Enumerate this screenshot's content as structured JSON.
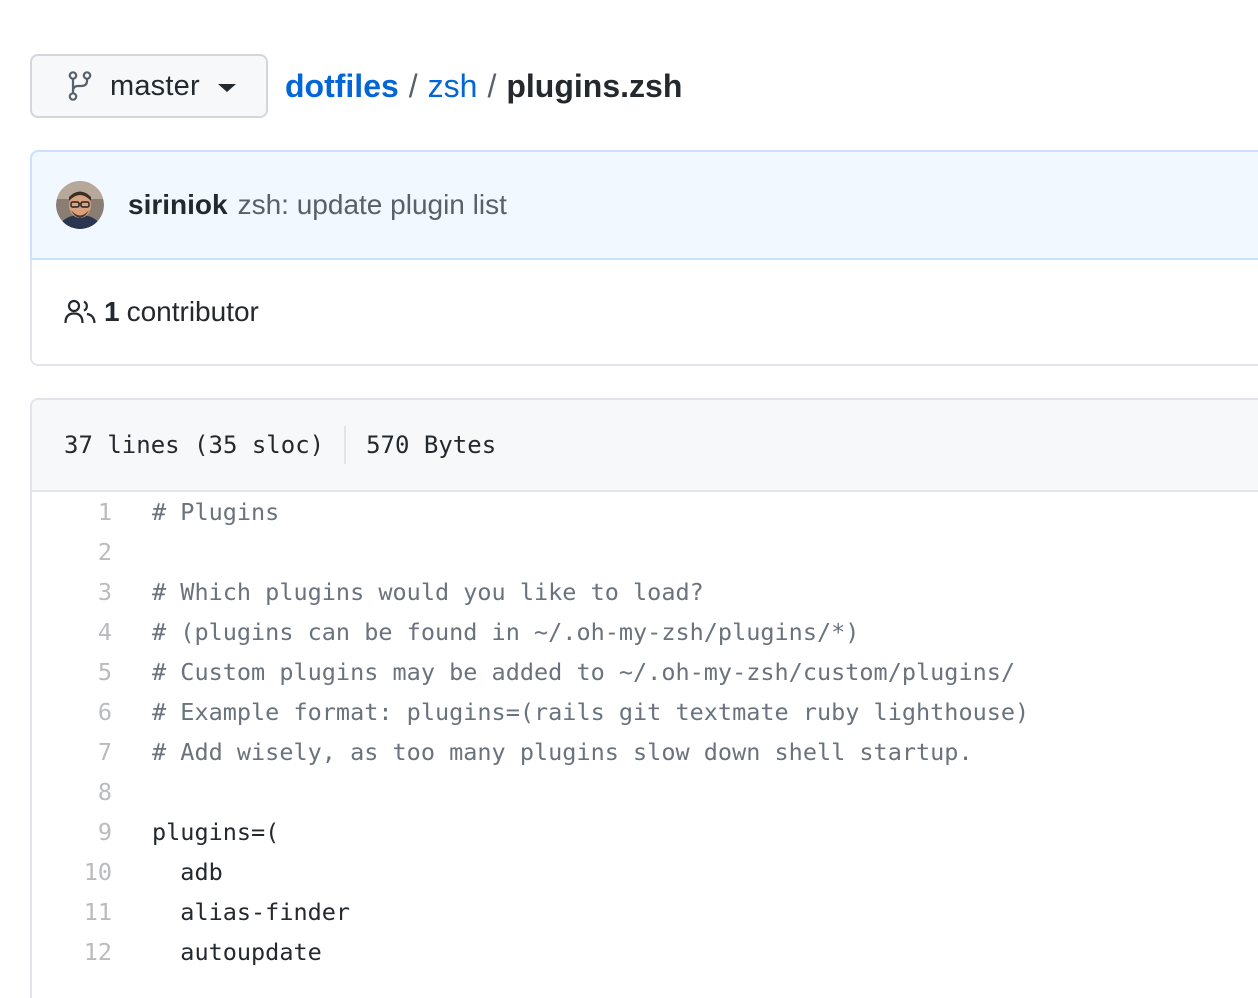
{
  "branch": {
    "name": "master",
    "icon": "git-branch-icon"
  },
  "breadcrumb": {
    "repo": "dotfiles",
    "sep1": "/",
    "folder": "zsh",
    "sep2": "/",
    "file": "plugins.zsh"
  },
  "commit": {
    "avatar_icon": "user-avatar",
    "author": "siriniok",
    "message": "zsh: update plugin list"
  },
  "contributors": {
    "icon": "people-icon",
    "count": "1",
    "label": "contributor"
  },
  "file_info": {
    "lines": "37 lines (35 sloc)",
    "size": "570 Bytes"
  },
  "code": {
    "lines": [
      {
        "num": "1",
        "text": "# Plugins",
        "comment": true
      },
      {
        "num": "2",
        "text": "",
        "comment": false
      },
      {
        "num": "3",
        "text": "# Which plugins would you like to load?",
        "comment": true
      },
      {
        "num": "4",
        "text": "# (plugins can be found in ~/.oh-my-zsh/plugins/*)",
        "comment": true
      },
      {
        "num": "5",
        "text": "# Custom plugins may be added to ~/.oh-my-zsh/custom/plugins/",
        "comment": true
      },
      {
        "num": "6",
        "text": "# Example format: plugins=(rails git textmate ruby lighthouse)",
        "comment": true
      },
      {
        "num": "7",
        "text": "# Add wisely, as too many plugins slow down shell startup.",
        "comment": true
      },
      {
        "num": "8",
        "text": "",
        "comment": false
      },
      {
        "num": "9",
        "text": "plugins=(",
        "comment": false
      },
      {
        "num": "10",
        "text": "  adb",
        "comment": false
      },
      {
        "num": "11",
        "text": "  alias-finder",
        "comment": false
      },
      {
        "num": "12",
        "text": "  autoupdate",
        "comment": false
      }
    ]
  },
  "colors": {
    "link": "#0366d6",
    "commit_bg": "#f1f8ff",
    "comment": "#6a737d",
    "line_number": "#babbbd"
  }
}
